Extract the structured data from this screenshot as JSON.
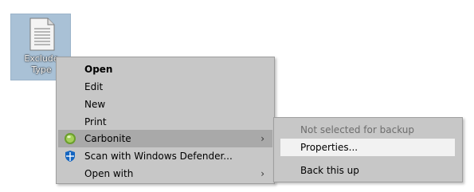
{
  "desktop": {
    "file": {
      "label_line1": "Exclude",
      "label_line2": "Type",
      "icon": "document-icon"
    }
  },
  "context_menu": {
    "items": [
      {
        "label": "Open",
        "bold": true
      },
      {
        "label": "Edit"
      },
      {
        "label": "New"
      },
      {
        "label": "Print"
      },
      {
        "label": "Carbonite",
        "icon": "carbonite-icon",
        "submenu_arrow": "›",
        "highlighted": true
      },
      {
        "label": "Scan with Windows Defender...",
        "icon": "windows-defender-icon"
      },
      {
        "label": "Open with",
        "submenu_arrow": "›"
      }
    ]
  },
  "carbonite_submenu": {
    "items": [
      {
        "label": "Not selected for backup",
        "disabled": true
      },
      {
        "label": "Properties...",
        "highlighted": true
      },
      {
        "label": "Back this up"
      }
    ]
  },
  "colors": {
    "menu_bg": "#c7c7c7",
    "menu_highlight": "#a9a9a9",
    "submenu_highlight": "#f2f2f2",
    "file_selection": "#a9c1d6",
    "carbonite_green": "#8bc34a",
    "defender_blue": "#1565c0"
  }
}
